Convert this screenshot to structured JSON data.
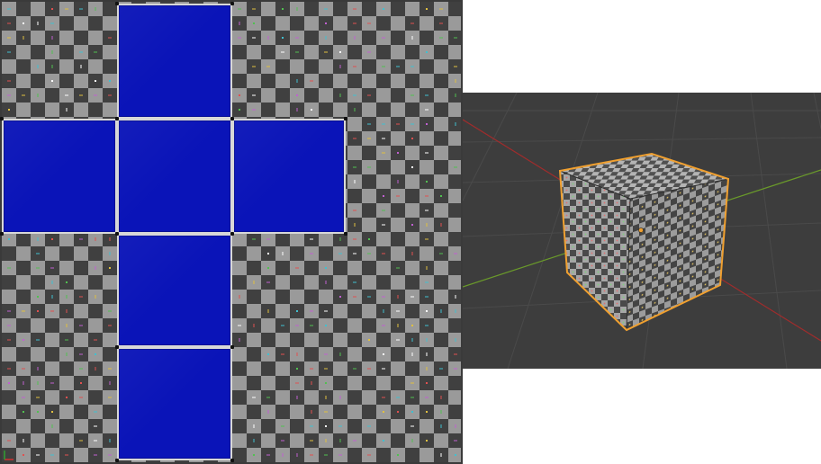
{
  "uv_editor": {
    "texture": "checker-grid",
    "face_color": "#0a14b8",
    "face_outline_color": "#d8d8d8"
  },
  "viewport": {
    "object": "cube",
    "object_texture": "checker-grid",
    "selection_outline_color": "#f0a030",
    "x_axis_color": "#a02c2c",
    "y_axis_color": "#6a9a2a",
    "origin_color": "#f0a030",
    "background_color": "#3d3d3d"
  },
  "icons": {
    "uv_axis": "uv-axis-icon",
    "origin": "object-origin-icon"
  }
}
